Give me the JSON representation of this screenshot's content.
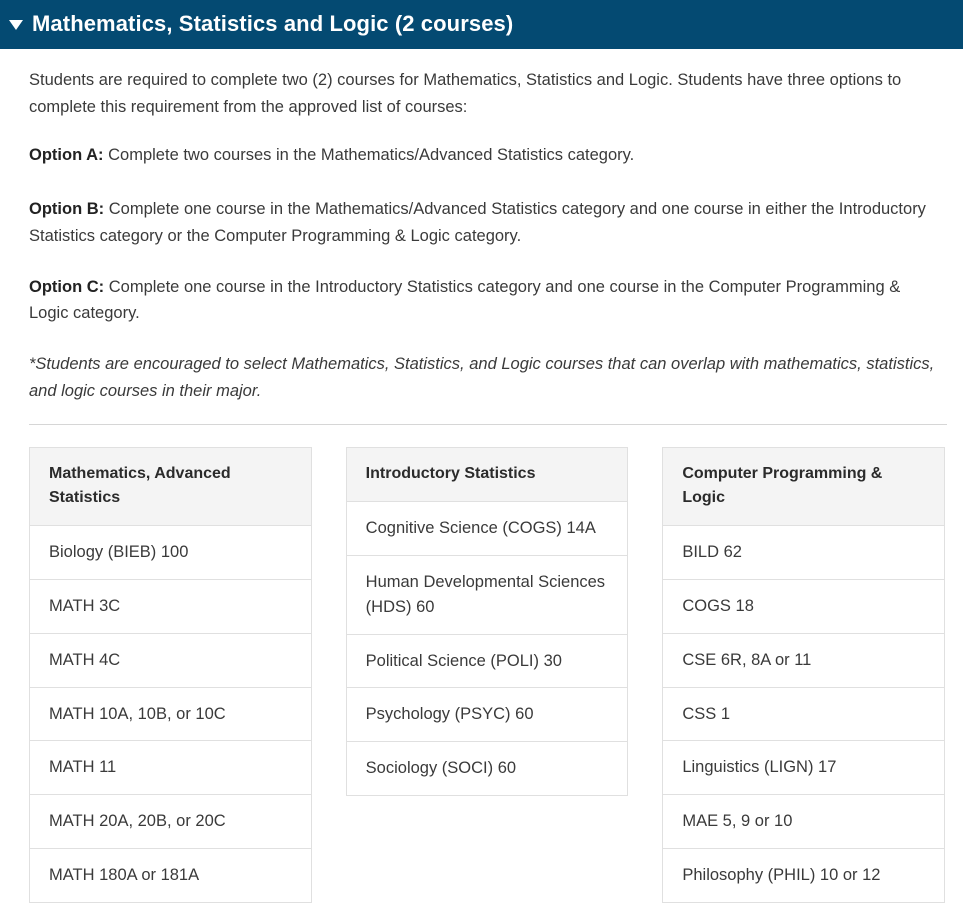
{
  "accordion": {
    "caret_icon": "chevron-down-icon",
    "title": "Mathematics, Statistics and Logic (2 courses)",
    "expanded": true,
    "header_color": "#044a72"
  },
  "body": {
    "intro": "Students are required to complete two (2) courses for Mathematics, Statistics and Logic. Students have three options to complete this requirement from the approved list of courses:",
    "options": [
      {
        "lead": "Option A:",
        "text": " Complete two courses in the Mathematics/Advanced Statistics category."
      },
      {
        "lead": "Option B:",
        "text": " Complete one course in the Mathematics/Advanced Statistics category and one course in either the Introductory Statistics category or the Computer Programming & Logic category."
      },
      {
        "lead": "Option C:",
        "text": " Complete one course in the Introductory Statistics category and one course in the Computer Programming & Logic category."
      }
    ],
    "note": "*Students are encouraged to select Mathematics, Statistics, and Logic courses that can overlap with mathematics, statistics, and logic courses in their major."
  },
  "tables": [
    {
      "header": "Mathematics, Advanced Statistics",
      "rows": [
        "Biology (BIEB) 100",
        "MATH 3C",
        "MATH 4C",
        "MATH 10A, 10B, or 10C",
        "MATH 11",
        "MATH 20A, 20B, or 20C",
        "MATH 180A or 181A"
      ]
    },
    {
      "header": "Introductory Statistics",
      "rows": [
        "Cognitive Science (COGS) 14A",
        "Human Developmental Sciences (HDS) 60",
        "Political Science (POLI) 30",
        "Psychology (PSYC) 60",
        "Sociology (SOCI) 60"
      ]
    },
    {
      "header": "Computer Programming & Logic",
      "rows": [
        "BILD 62",
        "COGS 18",
        "CSE 6R, 8A or 11",
        "CSS 1",
        "Linguistics (LIGN) 17",
        "MAE 5, 9 or 10",
        "Philosophy (PHIL) 10 or 12"
      ]
    }
  ]
}
